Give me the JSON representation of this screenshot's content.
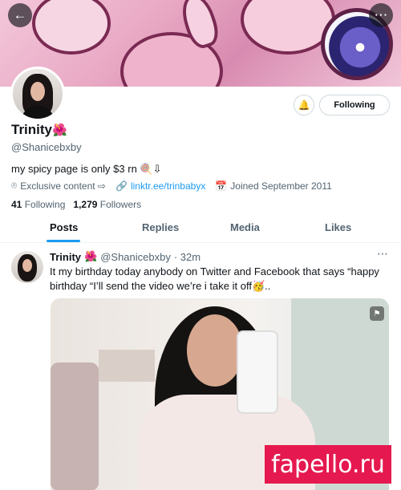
{
  "profile": {
    "name": "Trinity",
    "name_emoji": "🌺",
    "handle": "@Shanicebxby",
    "bio": "my spicy page is only $3 rn 🍭⇩",
    "meta": {
      "category": "Exclusive content ⇨",
      "link": "linktr.ee/trinbabyx",
      "joined": "Joined September 2011"
    },
    "following_count": "41",
    "following_label": "Following",
    "followers_count": "1,279",
    "followers_label": "Followers"
  },
  "actions": {
    "follow_label": "Following"
  },
  "tabs": [
    {
      "label": "Posts"
    },
    {
      "label": "Replies"
    },
    {
      "label": "Media"
    },
    {
      "label": "Likes"
    }
  ],
  "post": {
    "name": "Trinity",
    "emoji": "🌺",
    "handle": "@Shanicebxby",
    "time": "· 32m",
    "text": "It my birthday today anybody on Twitter and Facebook that says “happy birthday “I’ll send the video we’re i take it off🥳.."
  },
  "watermark": "fapello.ru"
}
